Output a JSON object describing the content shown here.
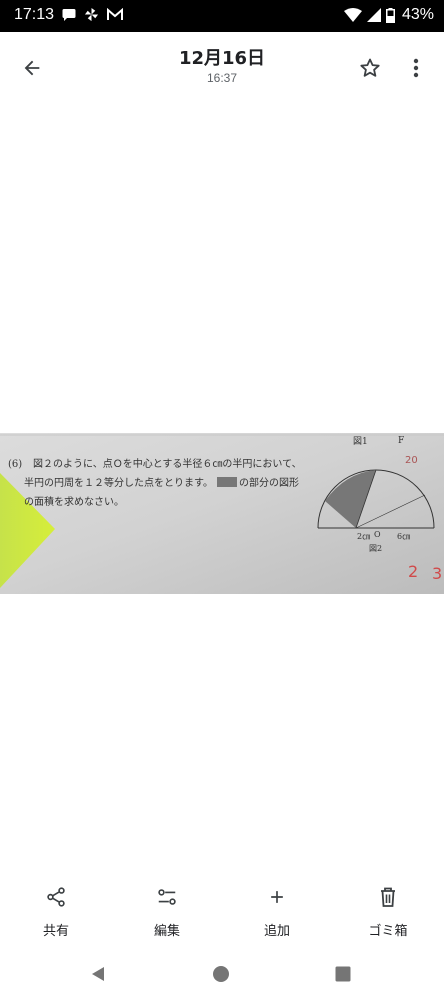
{
  "status_bar": {
    "time": "17:13",
    "battery_text": "43%",
    "left_icons": [
      "chat-bubble-icon",
      "pinwheel-icon",
      "gmail-icon"
    ],
    "right_icons": [
      "wifi-icon",
      "cell-signal-icon",
      "battery-icon"
    ]
  },
  "header": {
    "title": "12月16日",
    "subtitle": "16:37",
    "back_icon": "arrow-left-icon",
    "star_icon": "star-outline-icon",
    "more_icon": "more-vert-icon"
  },
  "photo": {
    "problem_number": "(6)",
    "problem_text_line1": "図２のように、点Ｏを中心とする半径６㎝の半円において、",
    "problem_text_line2": "半円の円周を１２等分した点をとります。",
    "problem_text_line2b": "の部分の図形",
    "problem_text_line3": "の面積を求めなさい。",
    "figure_title": "図1",
    "figure_caption": "図2",
    "label_2cm": "2㎝",
    "label_O": "O",
    "label_6cm": "6㎝",
    "label_F": "F",
    "handwritten_2": "2",
    "handwritten_3": "3",
    "handwritten_20": "20"
  },
  "toolbar": {
    "share_label": "共有",
    "edit_label": "編集",
    "add_label": "追加",
    "trash_label": "ゴミ箱"
  }
}
